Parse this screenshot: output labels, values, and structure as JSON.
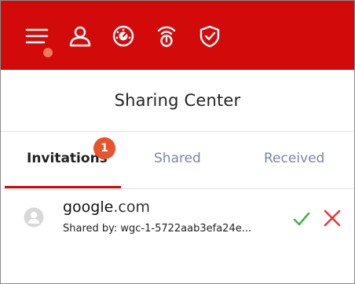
{
  "toolbar": {
    "icons": [
      "menu-icon",
      "user-icon",
      "dashboard-icon",
      "alarm-icon",
      "shield-check-icon"
    ],
    "brand_color": "#d20a0a",
    "notification_dot_color": "#f2785a"
  },
  "header": {
    "title": "Sharing Center"
  },
  "tabs": {
    "invitations": "Invitations",
    "shared": "Shared",
    "received": "Received",
    "invitations_badge": "1",
    "active": "Invitations",
    "active_color": "#d20a0a",
    "inactive_color": "#7b86a8"
  },
  "invitation": {
    "domain_name": "google",
    "domain_tld": ".com",
    "shared_by": "Shared by: wgc-1-5722aab3efa24e..."
  },
  "actions": {
    "accept_icon": "check-icon",
    "accept_color": "#4caf50",
    "decline_icon": "close-icon",
    "decline_color": "#e53935"
  }
}
